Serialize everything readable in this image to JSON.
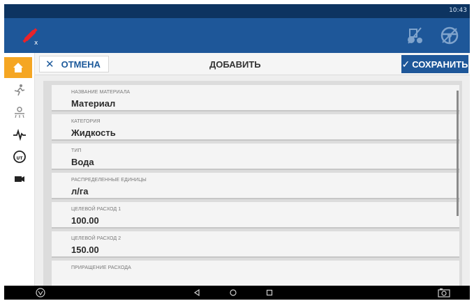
{
  "status_bar": {
    "time": "10:43"
  },
  "toolbar": {
    "cancel_label": "ОТМЕНА",
    "title": "ДОБАВИТЬ",
    "save_label": "СОХРАНИТЬ"
  },
  "fields": [
    {
      "label": "НАЗВАНИЕ МАТЕРИАЛА",
      "value": "Материал"
    },
    {
      "label": "КАТЕГОРИЯ",
      "value": "Жидкость"
    },
    {
      "label": "ТИП",
      "value": "Вода"
    },
    {
      "label": "РАСПРЕДЕЛЕННЫЕ ЕДИНИЦЫ",
      "value": "л/га"
    },
    {
      "label": "ЦЕЛЕВОЙ РАСХОД 1",
      "value": "100.00"
    },
    {
      "label": "ЦЕЛЕВОЙ РАСХОД 2",
      "value": "150.00"
    },
    {
      "label": "ПРИРАЩЕНИЕ РАСХОДА",
      "value": ""
    }
  ],
  "colors": {
    "status_bar": "#0d3461",
    "app_bar": "#1e5799",
    "accent": "#f5a623",
    "save_button": "#1e5799"
  },
  "icons": {
    "app_bar": [
      "gps-satellite-icon",
      "tractor-icon",
      "steering-wheel-icon"
    ],
    "sidebar": [
      "home-icon",
      "guidance-icon",
      "sprayer-icon",
      "diagnostics-icon",
      "isobus-ut-icon",
      "camera-icon"
    ],
    "nav": [
      "app-logo-icon",
      "back-icon",
      "home-circle-icon",
      "recents-icon",
      "screenshot-icon"
    ]
  }
}
